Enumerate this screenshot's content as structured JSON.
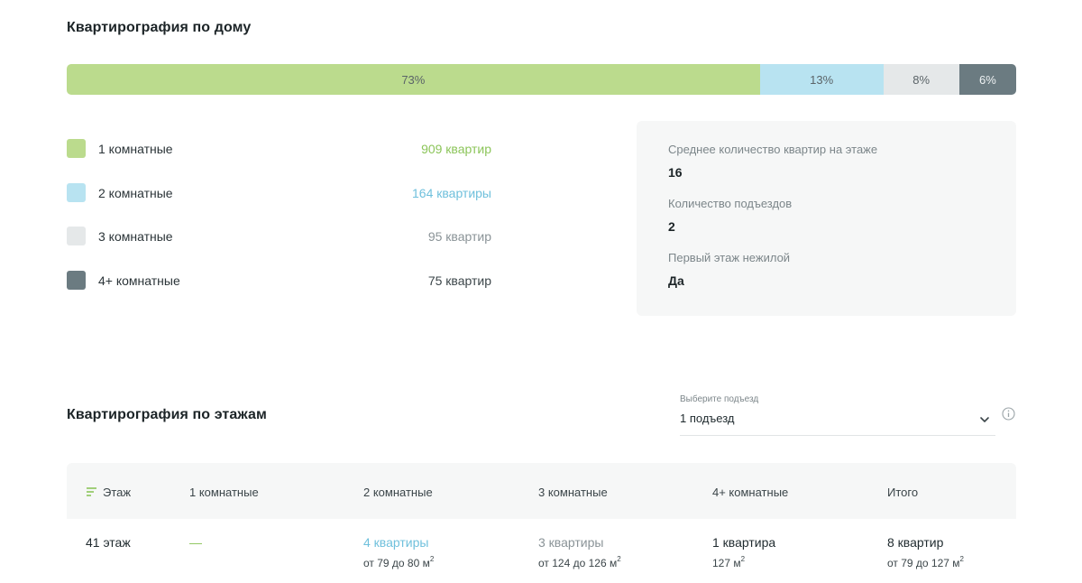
{
  "house": {
    "title": "Квартирография по дому",
    "bar": [
      {
        "label": "73%",
        "percent": 73,
        "color": "#bbdb8d"
      },
      {
        "label": "13%",
        "percent": 13,
        "color": "#b8e3f1"
      },
      {
        "label": "8%",
        "percent": 8,
        "color": "#e5e8e9"
      },
      {
        "label": "6%",
        "percent": 6,
        "color": "#6b7b81"
      }
    ],
    "legend": [
      {
        "label": "1 комнатные",
        "count": "909 квартир",
        "color": "#bbdb8d",
        "count_color": "#8cc55a"
      },
      {
        "label": "2 комнатные",
        "count": "164 квартиры",
        "color": "#b8e3f1",
        "count_color": "#6fc0dc"
      },
      {
        "label": "3 комнатные",
        "count": "95 квартир",
        "color": "#e5e8e9",
        "count_color": "#8a9397"
      },
      {
        "label": "4+ комнатные",
        "count": "75 квартир",
        "color": "#6b7b81",
        "count_color": "#3b4549"
      }
    ],
    "stats": [
      {
        "label": "Среднее количество квартир на этаже",
        "value": "16"
      },
      {
        "label": "Количество подъездов",
        "value": "2"
      },
      {
        "label": "Первый этаж нежилой",
        "value": "Да"
      }
    ]
  },
  "floors": {
    "title": "Квартирография по этажам",
    "select": {
      "caption": "Выберите подъезд",
      "value": "1 подъезд"
    },
    "columns": [
      "Этаж",
      "1 комнатные",
      "2 комнатные",
      "3 комнатные",
      "4+ комнатные",
      "Итого"
    ],
    "rows": [
      {
        "floor": "41 этаж",
        "c1": "—",
        "c2": "4 квартиры",
        "c2_sub": "от 79 до 80 м",
        "c3": "3 квартиры",
        "c3_sub": "от 124 до 126 м",
        "c4": "1 квартира",
        "c4_sub": "127 м",
        "total": "8 квартир",
        "total_sub": "от 79 до 127 м",
        "unit_sup": "2"
      }
    ]
  },
  "icons": {
    "sort": "sort-lines-icon",
    "chevron": "chevron-down-icon",
    "info": "info-circle-icon"
  },
  "colors": {
    "green": "#bbdb8d",
    "blue": "#b8e3f1",
    "grey": "#e5e8e9",
    "dark": "#6b7b81",
    "card_bg": "#f6f7f7"
  }
}
